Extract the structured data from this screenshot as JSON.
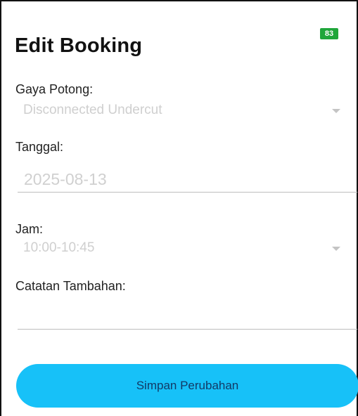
{
  "status": {
    "badge": "83"
  },
  "page": {
    "title": "Edit Booking"
  },
  "form": {
    "style": {
      "label": "Gaya Potong:",
      "value": "Disconnected Undercut"
    },
    "date": {
      "label": "Tanggal:",
      "value": "2025-08-13"
    },
    "time": {
      "label": "Jam:",
      "value": "10:00-10:45"
    },
    "notes": {
      "label": "Catatan Tambahan:",
      "value": ""
    }
  },
  "actions": {
    "save_label": "Simpan Perubahan"
  },
  "colors": {
    "accent": "#17c1f8",
    "badge": "#1fa63a",
    "muted_text": "#cfcfcf"
  }
}
